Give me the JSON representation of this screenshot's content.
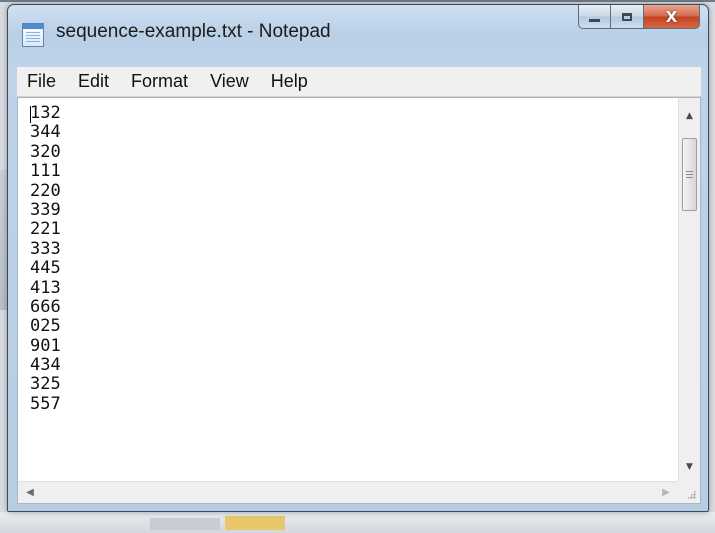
{
  "window": {
    "title": "sequence-example.txt - Notepad",
    "buttons": {
      "minimize_glyph": "",
      "maximize_glyph": "",
      "close_glyph": "X"
    },
    "icon": "notepad-icon"
  },
  "menu": {
    "items": [
      {
        "label": "File"
      },
      {
        "label": "Edit"
      },
      {
        "label": "Format"
      },
      {
        "label": "View"
      },
      {
        "label": "Help"
      }
    ]
  },
  "document": {
    "lines": [
      "132",
      "344",
      "320",
      "111",
      "220",
      "339",
      "221",
      "333",
      "445",
      "413",
      "666",
      "025",
      "901",
      "434",
      "325",
      "557"
    ]
  },
  "scrollbars": {
    "vertical": {
      "up_arrow": "▲",
      "down_arrow": "▼"
    },
    "horizontal": {
      "left_arrow": "◀",
      "right_arrow": "▶"
    }
  },
  "colors": {
    "close_button": "#c2401f",
    "frame": "#b9cfe6",
    "editor_background": "#ffffff"
  }
}
